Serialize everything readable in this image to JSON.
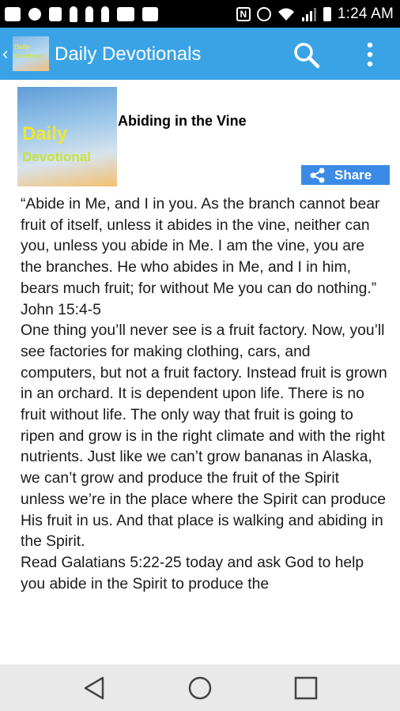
{
  "status_bar": {
    "time": "1:24 AM",
    "nfc_label": "N",
    "left_icons": [
      "message-icon",
      "snapchat-icon",
      "tools-icon",
      "chess-icon",
      "chess-icon",
      "chess-icon",
      "mail-icon",
      "image-icon"
    ],
    "right_icons": [
      "nfc-icon",
      "alarm-icon",
      "wifi-icon",
      "signal-icon",
      "battery-icon"
    ]
  },
  "app_bar": {
    "title": "Daily Devotionals",
    "icon_line1": "Daily",
    "icon_line2": "Devotional",
    "back_glyph": "‹",
    "background": "#3aa3e6"
  },
  "devotional": {
    "image_line1": "Daily",
    "image_line2": "Devotional",
    "title": "Abiding in the Vine",
    "share_label": "Share",
    "share_color": "#3b8be6",
    "body": "“Abide in Me, and I in you. As the branch cannot bear fruit of itself, unless it abides in the vine, neither can you, unless you abide in Me. I am the vine, you are the branches. He who abides in Me, and I in him, bears much fruit; for without Me you can do nothing.”\nJohn 15:4-5\nOne thing you’ll never see is a fruit factory. Now, you’ll see factories for making clothing, cars, and computers, but not a fruit factory. Instead fruit is grown in an orchard. It is dependent upon life. There is no fruit without life. The only way that fruit is going to ripen and grow is in the right climate and with the right nutrients. Just like we can’t grow bananas in Alaska, we can’t grow and produce the fruit of the Spirit unless we’re in the place where the Spirit can produce His fruit in us. And that place is walking and abiding in the Spirit.\nRead Galatians 5:22-25 today and ask God to help you abide in the Spirit to produce the"
  },
  "nav_bar": {
    "buttons": [
      "back-icon",
      "home-icon",
      "recents-icon"
    ]
  }
}
